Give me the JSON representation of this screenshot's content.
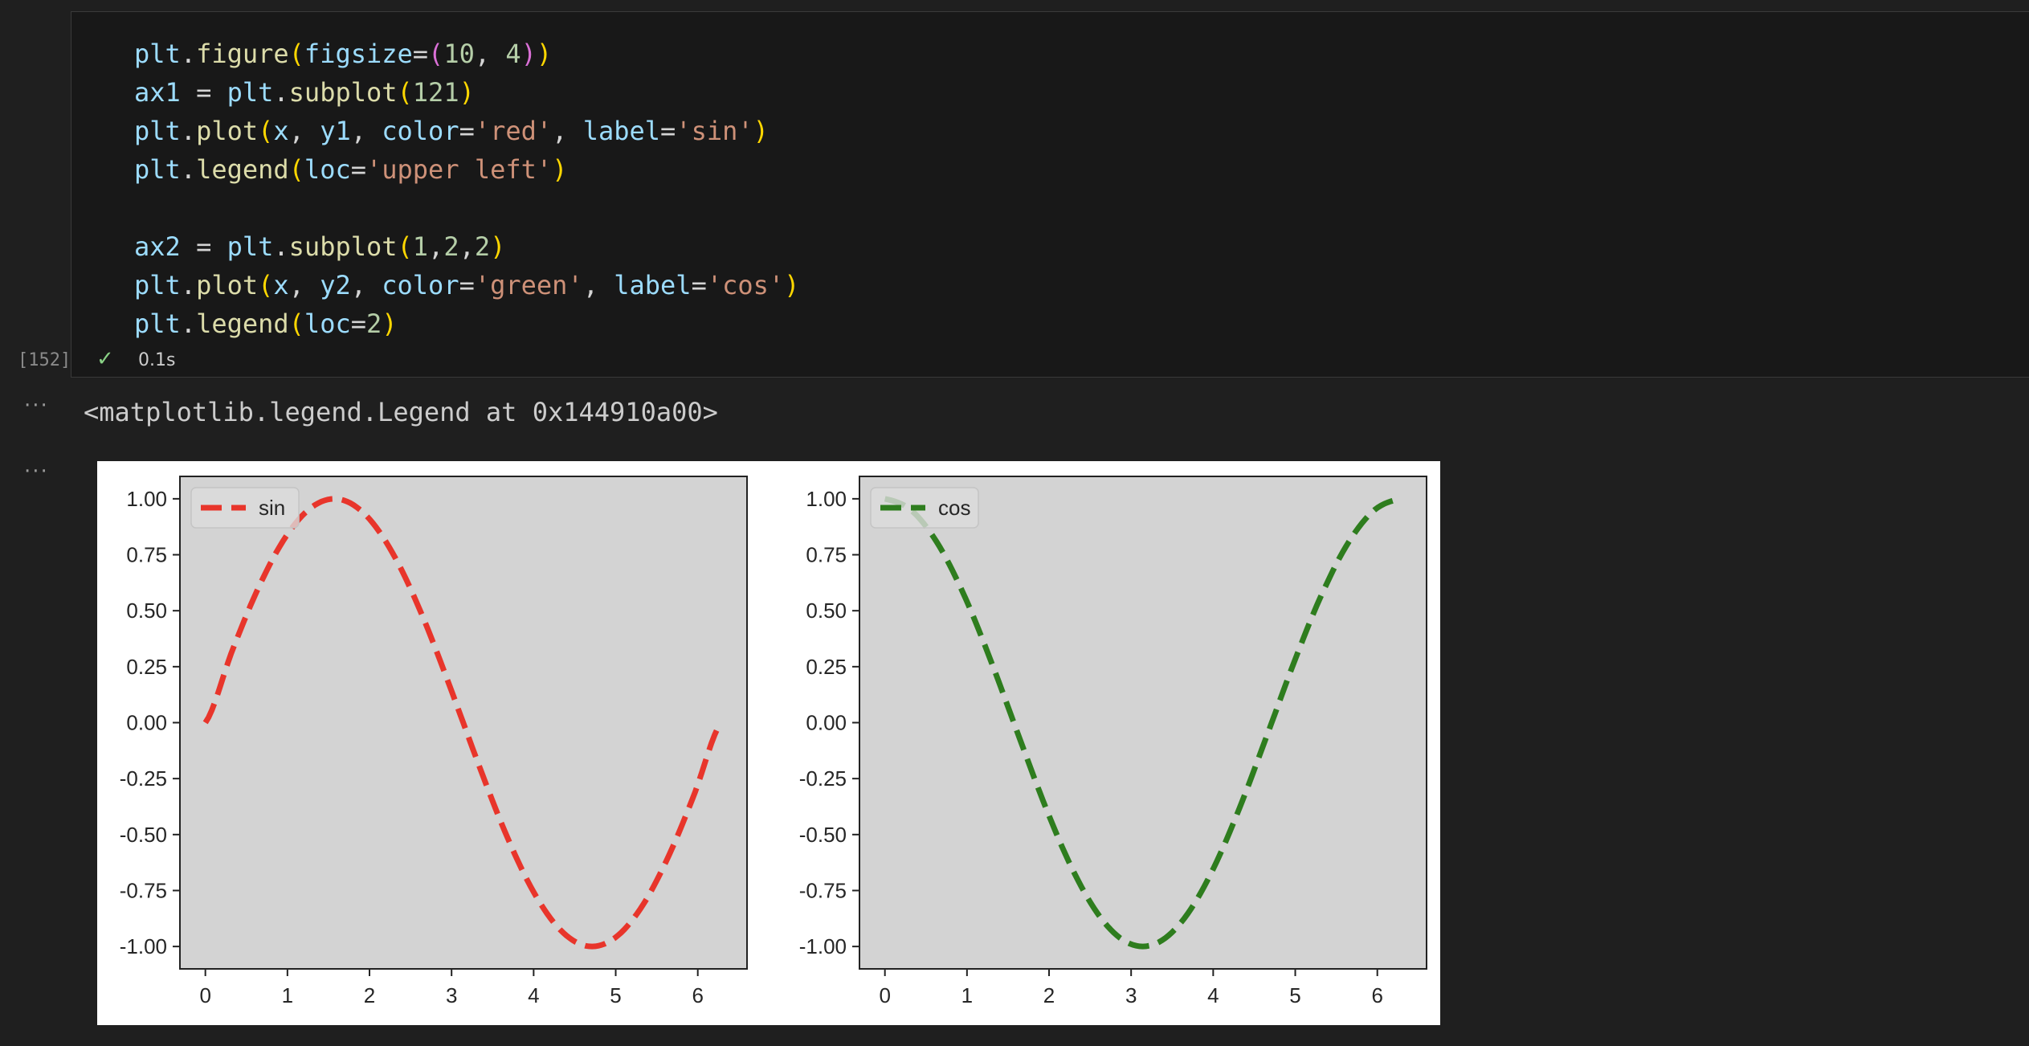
{
  "cell": {
    "execution_count": "[152]",
    "status_time": "0.1s",
    "code_lines": [
      [
        [
          "plt",
          "t-mod"
        ],
        [
          ".",
          "t-op"
        ],
        [
          "figure",
          "t-fn"
        ],
        [
          "(",
          "t-p1"
        ],
        [
          "figsize",
          "t-kw"
        ],
        [
          "=",
          "t-op"
        ],
        [
          "(",
          "t-p2"
        ],
        [
          "10",
          "t-num"
        ],
        [
          ", ",
          "t-op"
        ],
        [
          "4",
          "t-num"
        ],
        [
          ")",
          "t-p2"
        ],
        [
          ")",
          "t-p1"
        ]
      ],
      [
        [
          "ax1",
          "t-var"
        ],
        [
          " = ",
          "t-op"
        ],
        [
          "plt",
          "t-mod"
        ],
        [
          ".",
          "t-op"
        ],
        [
          "subplot",
          "t-fn"
        ],
        [
          "(",
          "t-p1"
        ],
        [
          "121",
          "t-num"
        ],
        [
          ")",
          "t-p1"
        ]
      ],
      [
        [
          "plt",
          "t-mod"
        ],
        [
          ".",
          "t-op"
        ],
        [
          "plot",
          "t-fn"
        ],
        [
          "(",
          "t-p1"
        ],
        [
          "x",
          "t-var"
        ],
        [
          ", ",
          "t-op"
        ],
        [
          "y1",
          "t-var"
        ],
        [
          ", ",
          "t-op"
        ],
        [
          "color",
          "t-kw"
        ],
        [
          "=",
          "t-op"
        ],
        [
          "'red'",
          "t-str"
        ],
        [
          ", ",
          "t-op"
        ],
        [
          "label",
          "t-kw"
        ],
        [
          "=",
          "t-op"
        ],
        [
          "'sin'",
          "t-str"
        ],
        [
          ")",
          "t-p1"
        ]
      ],
      [
        [
          "plt",
          "t-mod"
        ],
        [
          ".",
          "t-op"
        ],
        [
          "legend",
          "t-fn"
        ],
        [
          "(",
          "t-p1"
        ],
        [
          "loc",
          "t-kw"
        ],
        [
          "=",
          "t-op"
        ],
        [
          "'upper left'",
          "t-str"
        ],
        [
          ")",
          "t-p1"
        ]
      ],
      [],
      [
        [
          "ax2",
          "t-var"
        ],
        [
          " = ",
          "t-op"
        ],
        [
          "plt",
          "t-mod"
        ],
        [
          ".",
          "t-op"
        ],
        [
          "subplot",
          "t-fn"
        ],
        [
          "(",
          "t-p1"
        ],
        [
          "1",
          "t-num"
        ],
        [
          ",",
          "t-op"
        ],
        [
          "2",
          "t-num"
        ],
        [
          ",",
          "t-op"
        ],
        [
          "2",
          "t-num"
        ],
        [
          ")",
          "t-p1"
        ]
      ],
      [
        [
          "plt",
          "t-mod"
        ],
        [
          ".",
          "t-op"
        ],
        [
          "plot",
          "t-fn"
        ],
        [
          "(",
          "t-p1"
        ],
        [
          "x",
          "t-var"
        ],
        [
          ", ",
          "t-op"
        ],
        [
          "y2",
          "t-var"
        ],
        [
          ", ",
          "t-op"
        ],
        [
          "color",
          "t-kw"
        ],
        [
          "=",
          "t-op"
        ],
        [
          "'green'",
          "t-str"
        ],
        [
          ", ",
          "t-op"
        ],
        [
          "label",
          "t-kw"
        ],
        [
          "=",
          "t-op"
        ],
        [
          "'cos'",
          "t-str"
        ],
        [
          ")",
          "t-p1"
        ]
      ],
      [
        [
          "plt",
          "t-mod"
        ],
        [
          ".",
          "t-op"
        ],
        [
          "legend",
          "t-fn"
        ],
        [
          "(",
          "t-p1"
        ],
        [
          "loc",
          "t-kw"
        ],
        [
          "=",
          "t-op"
        ],
        [
          "2",
          "t-num"
        ],
        [
          ")",
          "t-p1"
        ]
      ]
    ]
  },
  "output": {
    "ellipsis": "···",
    "text": "<matplotlib.legend.Legend at 0x144910a00>"
  },
  "chart_data": [
    {
      "type": "line",
      "title": "",
      "xlabel": "",
      "ylabel": "",
      "xlim": [
        -0.31,
        6.6
      ],
      "ylim": [
        -1.1,
        1.1
      ],
      "xticks": [
        "0",
        "1",
        "2",
        "3",
        "4",
        "5",
        "6"
      ],
      "yticks": [
        "1.00",
        "0.75",
        "0.50",
        "0.25",
        "0.00",
        "-0.25",
        "-0.50",
        "-0.75",
        "-1.00"
      ],
      "legend_loc": "upper-left",
      "background": "#d3d3d3",
      "series": [
        {
          "name": "sin",
          "color": "#e8352b",
          "linestyle": "dashed",
          "x": [
            0,
            0.3307,
            0.6614,
            0.9921,
            1.3228,
            1.6535,
            1.9842,
            2.3149,
            2.6456,
            2.9762,
            3.3069,
            3.6376,
            3.9683,
            4.299,
            4.6297,
            4.9604,
            5.2911,
            5.6218,
            5.9525,
            6.2832
          ],
          "y": [
            0,
            0.3247,
            0.6142,
            0.8372,
            0.9694,
            0.9966,
            0.9158,
            0.7357,
            0.4759,
            0.1646,
            -0.1646,
            -0.4759,
            -0.7357,
            -0.9158,
            -0.9966,
            -0.9694,
            -0.8372,
            -0.6142,
            -0.3247,
            0
          ]
        }
      ]
    },
    {
      "type": "line",
      "title": "",
      "xlabel": "",
      "ylabel": "",
      "xlim": [
        -0.31,
        6.6
      ],
      "ylim": [
        -1.1,
        1.1
      ],
      "xticks": [
        "0",
        "1",
        "2",
        "3",
        "4",
        "5",
        "6"
      ],
      "yticks": [
        "1.00",
        "0.75",
        "0.50",
        "0.25",
        "0.00",
        "-0.25",
        "-0.50",
        "-0.75",
        "-1.00"
      ],
      "legend_loc": "upper-left",
      "background": "#d3d3d3",
      "series": [
        {
          "name": "cos",
          "color": "#2e7d1e",
          "linestyle": "dashed",
          "x": [
            0,
            0.3307,
            0.6614,
            0.9921,
            1.3228,
            1.6535,
            1.9842,
            2.3149,
            2.6456,
            2.9762,
            3.3069,
            3.6376,
            3.9683,
            4.299,
            4.6297,
            4.9604,
            5.2911,
            5.6218,
            5.9525,
            6.2832
          ],
          "y": [
            1,
            0.9458,
            0.7891,
            0.5469,
            0.2455,
            -0.0826,
            -0.4017,
            -0.6773,
            -0.8795,
            -0.9864,
            -0.9864,
            -0.8795,
            -0.6773,
            -0.4017,
            -0.0826,
            0.2455,
            0.5469,
            0.7891,
            0.9458,
            1
          ]
        }
      ]
    }
  ]
}
